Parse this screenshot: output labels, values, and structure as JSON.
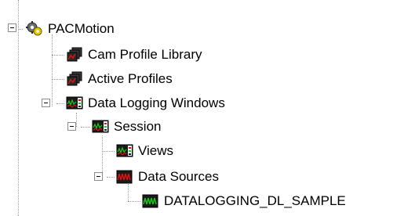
{
  "tree": {
    "nodes": [
      {
        "key": "root",
        "label": "PACMotion",
        "icon": "gear-cog-icon"
      },
      {
        "key": "cam_profile_library",
        "label": "Cam Profile Library",
        "icon": "cam-profile-stack-icon"
      },
      {
        "key": "active_profiles",
        "label": "Active Profiles",
        "icon": "cam-profile-stack-icon"
      },
      {
        "key": "data_logging_windows",
        "label": "Data Logging Windows",
        "icon": "data-logging-window-icon"
      },
      {
        "key": "session",
        "label": "Session",
        "icon": "data-logging-window-icon"
      },
      {
        "key": "views",
        "label": "Views",
        "icon": "data-logging-window-icon"
      },
      {
        "key": "data_sources",
        "label": "Data Sources",
        "icon": "red-waveform-icon"
      },
      {
        "key": "datalogging_dl_sample",
        "label": "DATALOGGING_DL_SAMPLE",
        "icon": "green-waveform-icon"
      }
    ],
    "colors": {
      "waveform_green": "#19c819",
      "waveform_red": "#e01010",
      "gear_yellow": "#e8c800",
      "connector": "#9a9a9a"
    }
  }
}
